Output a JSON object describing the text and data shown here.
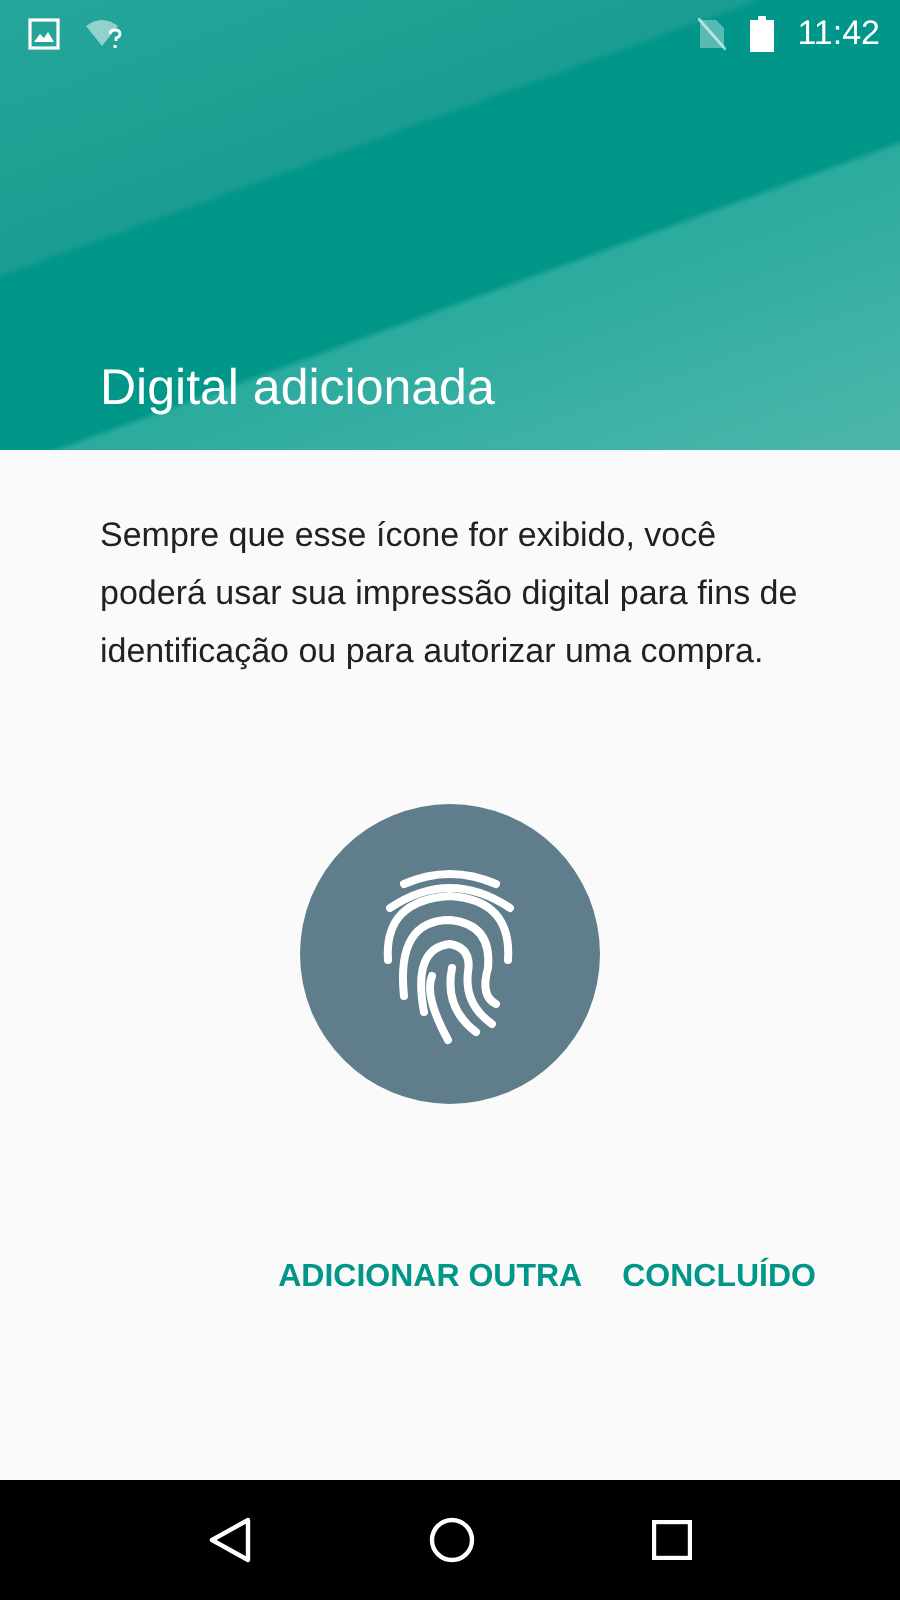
{
  "status_bar": {
    "time": "11:42"
  },
  "header": {
    "title": "Digital adicionada"
  },
  "body": {
    "text": "Sempre que esse ícone for exibido, você poderá usar sua impressão digital para fins de identificação ou para autorizar uma compra."
  },
  "buttons": [
    {
      "label": "ADICIONAR OUTRA"
    },
    {
      "label": "CONCLUÍDO"
    }
  ]
}
